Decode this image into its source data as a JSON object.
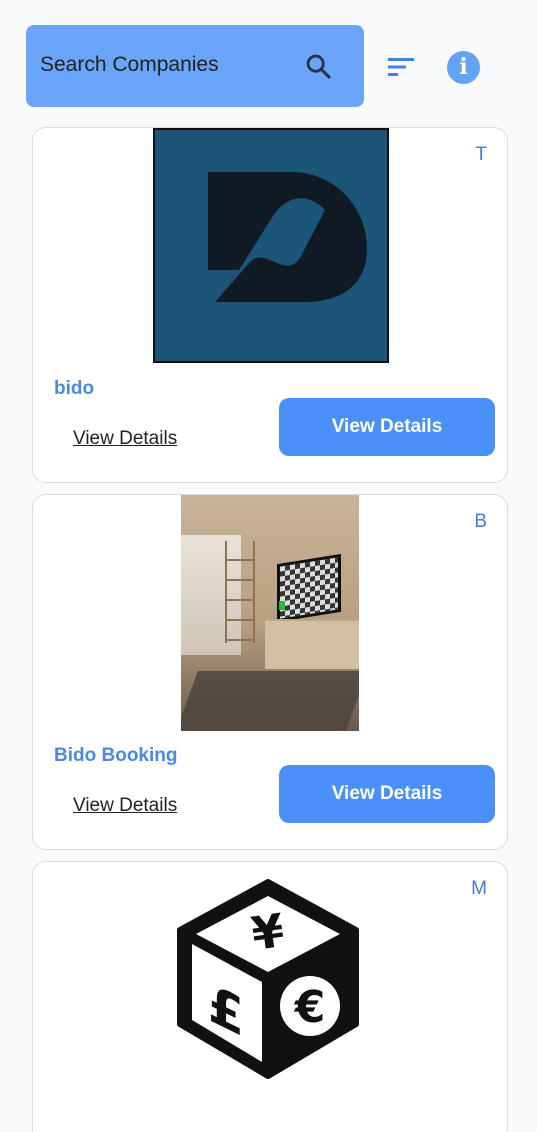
{
  "header": {
    "search_placeholder": "Search Companies"
  },
  "companies": [
    {
      "initial": "T",
      "name": "bido",
      "link_label": "View Details",
      "button_label": "View Details"
    },
    {
      "initial": "B",
      "name": "Bido Booking",
      "link_label": "View Details",
      "button_label": "View Details"
    },
    {
      "initial": "M"
    }
  ],
  "colors": {
    "primary": "#4a90f8",
    "search_bg": "#6aa5fa",
    "company_name": "#4a8ae6"
  }
}
